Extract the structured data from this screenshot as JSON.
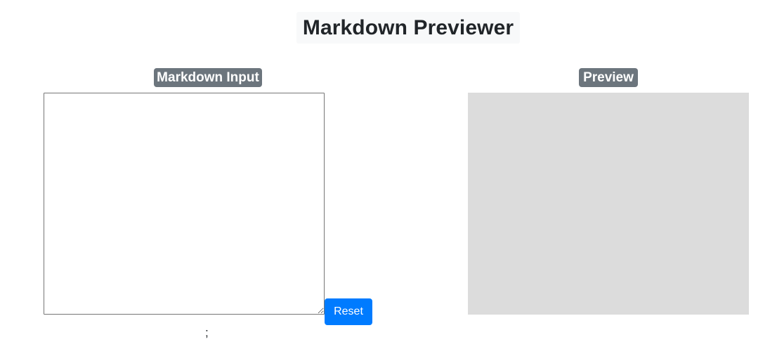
{
  "header": {
    "title": "Markdown Previewer"
  },
  "editor_panel": {
    "label": "Markdown Input",
    "textarea_value": "",
    "reset_label": "Reset",
    "footer_text": ";"
  },
  "preview_panel": {
    "label": "Preview",
    "content": ""
  },
  "colors": {
    "badge_bg": "#6c757d",
    "button_primary": "#007bff",
    "preview_bg": "#dcdcdc",
    "title_bg": "#f8f9fa"
  }
}
